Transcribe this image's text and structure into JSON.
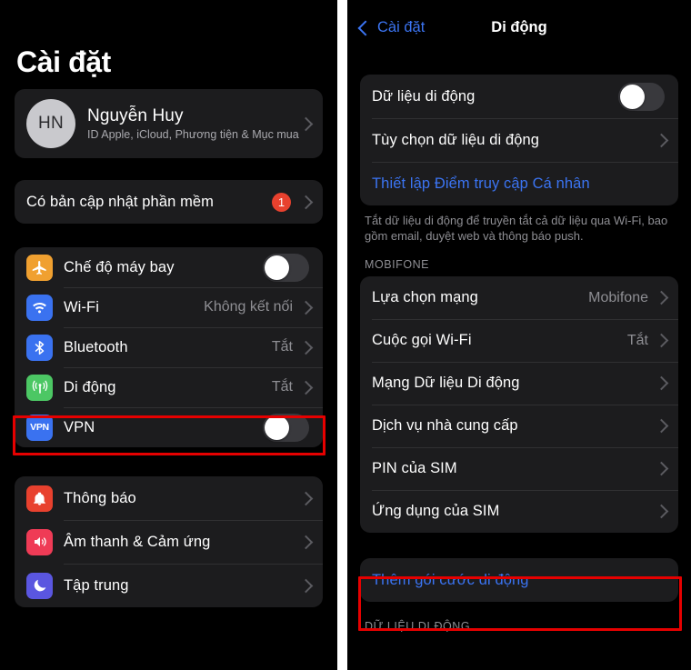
{
  "left_panel": {
    "title": "Cài đặt",
    "account": {
      "initials": "HN",
      "name": "Nguyễn Huy",
      "subtitle": "ID Apple, iCloud, Phương tiện & Mục mua"
    },
    "update_row": {
      "label": "Có bản cập nhật phần mềm",
      "badge": "1"
    },
    "connectivity": [
      {
        "label": "Chế độ máy bay",
        "icon": "airplane-icon",
        "icon_color": "#f0a030",
        "control": "toggle",
        "value": ""
      },
      {
        "label": "Wi-Fi",
        "icon": "wifi-icon",
        "icon_color": "#3a72f0",
        "control": "chevron",
        "value": "Không kết nối"
      },
      {
        "label": "Bluetooth",
        "icon": "bluetooth-icon",
        "icon_color": "#3a72f0",
        "control": "chevron",
        "value": "Tắt"
      },
      {
        "label": "Di động",
        "icon": "cellular-icon",
        "icon_color": "#4cc764",
        "control": "chevron",
        "value": "Tắt"
      },
      {
        "label": "VPN",
        "icon": "vpn-icon",
        "icon_color": "#3a72f0",
        "control": "toggle",
        "value": ""
      }
    ],
    "system": [
      {
        "label": "Thông báo",
        "icon": "bell-icon",
        "icon_color": "#e8412e"
      },
      {
        "label": "Âm thanh & Cảm ứng",
        "icon": "speaker-icon",
        "icon_color": "#ef3b56"
      },
      {
        "label": "Tập trung",
        "icon": "moon-icon",
        "icon_color": "#5a56e0"
      }
    ]
  },
  "right_panel": {
    "back_label": "Cài đặt",
    "nav_title": "Di động",
    "data_group": [
      {
        "label": "Dữ liệu di động",
        "control": "toggle",
        "value": ""
      },
      {
        "label": "Tùy chọn dữ liệu di động",
        "control": "chevron",
        "value": ""
      },
      {
        "label": "Thiết lập Điểm truy cập Cá nhân",
        "control": "link",
        "value": ""
      }
    ],
    "footnote": "Tắt dữ liệu di động để truyền tắt cả dữ liệu qua Wi-Fi, bao gồm email, duyệt web và thông báo push.",
    "carrier_header": "MOBIFONE",
    "carrier_rows": [
      {
        "label": "Lựa chọn mạng",
        "value": "Mobifone"
      },
      {
        "label": "Cuộc gọi Wi-Fi",
        "value": "Tắt"
      },
      {
        "label": "Mạng Dữ liệu Di động",
        "value": ""
      },
      {
        "label": "Dịch vụ nhà cung cấp",
        "value": ""
      },
      {
        "label": "PIN của SIM",
        "value": ""
      },
      {
        "label": "Ứng dụng của SIM",
        "value": ""
      }
    ],
    "add_plan_label": "Thêm gói cước di động",
    "bottom_header": "DỮ LIỆU DI ĐỘNG"
  },
  "annotations": {
    "highlight_color": "#e60000",
    "boxes": [
      "di-dong-row",
      "them-goi-cuoc-row"
    ]
  }
}
